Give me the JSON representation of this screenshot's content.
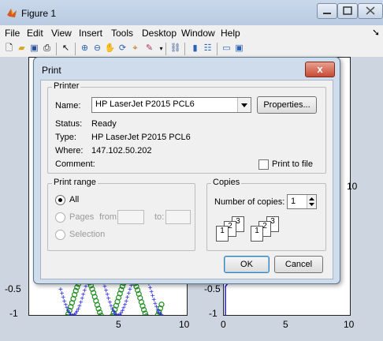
{
  "window": {
    "title": "Figure 1",
    "menu": [
      "File",
      "Edit",
      "View",
      "Insert",
      "Tools",
      "Desktop",
      "Window",
      "Help"
    ],
    "toolbar_icons": [
      "new-figure-icon",
      "open-file-icon",
      "save-icon",
      "print-icon",
      "pointer-icon",
      "zoom-in-icon",
      "zoom-out-icon",
      "pan-icon",
      "rotate-3d-icon",
      "data-cursor-icon",
      "brush-icon",
      "link-plot-icon",
      "colorbar-icon",
      "legend-icon",
      "hide-plot-tools-icon",
      "show-plot-tools-icon"
    ]
  },
  "plots": {
    "left": {
      "y_ticks": [
        "-0.5",
        "-1"
      ],
      "x_ticks": [
        "5",
        "10"
      ]
    },
    "right": {
      "y_ticks": [
        "-0.5",
        "-1"
      ],
      "x_ticks": [
        "0",
        "5",
        "10"
      ],
      "side_tick": "10"
    }
  },
  "chart_data": [
    {
      "type": "line",
      "note_series": [
        "blue",
        "green"
      ],
      "xlim": [
        0,
        10
      ],
      "ylim": [
        -1,
        1
      ],
      "x_ticks": [
        5,
        10
      ],
      "y_ticks": [
        -0.5,
        -1
      ],
      "colors": [
        "#1a1ae6",
        "#1f8f1f"
      ]
    },
    {
      "type": "line",
      "xlim": [
        0,
        10
      ],
      "ylim": [
        -1,
        1
      ],
      "x_ticks": [
        0,
        5,
        10
      ],
      "y_ticks": [
        -0.5,
        -1
      ],
      "colors": [
        "#1a1ae6"
      ]
    }
  ],
  "dialog": {
    "title": "Print",
    "printer": {
      "legend": "Printer",
      "name_label": "Name:",
      "name_value": "HP LaserJet P2015 PCL6",
      "properties_button": "Properties...",
      "status_label": "Status:",
      "status_value": "Ready",
      "type_label": "Type:",
      "type_value": "HP LaserJet P2015 PCL6",
      "where_label": "Where:",
      "where_value": "147.102.50.202",
      "comment_label": "Comment:",
      "print_to_file_label": "Print to file",
      "print_to_file_checked": false
    },
    "range": {
      "legend": "Print range",
      "all_label": "All",
      "pages_label": "Pages",
      "from_label": "from:",
      "to_label": "to:",
      "selection_label": "Selection",
      "selected": "All"
    },
    "copies": {
      "legend": "Copies",
      "number_label": "Number of copies:",
      "number_value": "1",
      "collate_digits": [
        "1",
        "2",
        "3"
      ]
    },
    "ok_button": "OK",
    "cancel_button": "Cancel",
    "close_glyph": "x"
  }
}
